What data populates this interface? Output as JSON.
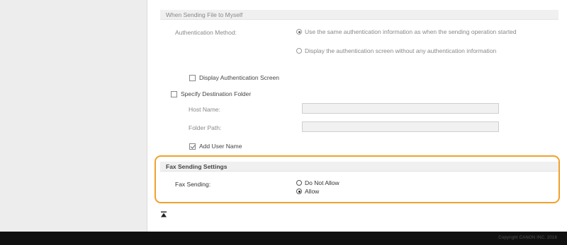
{
  "send_to_myself": {
    "section_title": "When Sending File to Myself",
    "auth_method_label": "Authentication Method:",
    "auth_options": [
      {
        "label": "Use the same authentication information as when the sending operation started",
        "selected": true
      },
      {
        "label": "Display the authentication screen without any authentication information",
        "selected": false
      }
    ],
    "display_auth_screen": {
      "label": "Display Authentication Screen",
      "checked": false
    },
    "specify_folder": {
      "label": "Specify Destination Folder",
      "checked": false
    },
    "host_name_label": "Host Name:",
    "host_name_value": "",
    "folder_path_label": "Folder Path:",
    "folder_path_value": "",
    "add_user_name": {
      "label": "Add User Name",
      "checked": true
    }
  },
  "fax_settings": {
    "section_title": "Fax Sending Settings",
    "fax_sending_label": "Fax Sending:",
    "options": [
      {
        "label": "Do Not Allow",
        "selected": false
      },
      {
        "label": "Allow",
        "selected": true
      }
    ]
  },
  "footer": {
    "copyright": "Copyright CANON INC. 2016"
  },
  "colors": {
    "highlight": "#f1a12a",
    "sidebar": "#ededed",
    "footer": "#101010"
  },
  "icons": {
    "back_to_top": "back-to-top-icon"
  }
}
